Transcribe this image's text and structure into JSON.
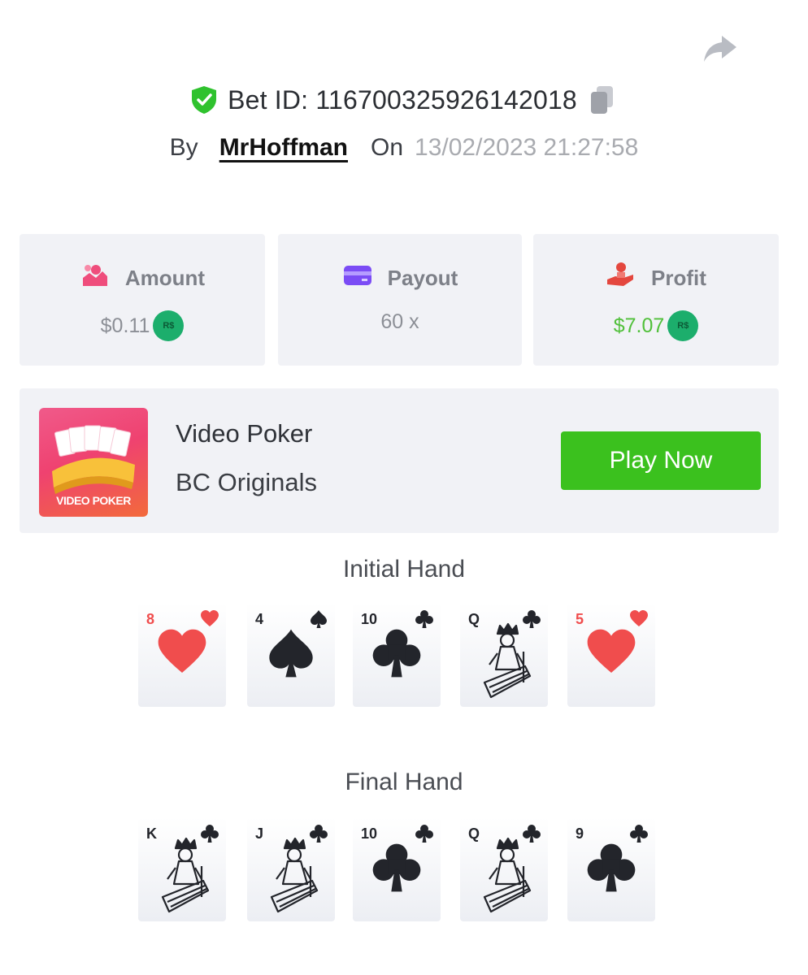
{
  "header": {
    "bet_id_label": "Bet ID: 116700325926142018",
    "by_label": "By",
    "username": "MrHoffman",
    "on_label": "On",
    "datetime": "13/02/2023 21:27:58"
  },
  "stats": {
    "amount": {
      "label": "Amount",
      "value": "$0.11",
      "coin": "R$"
    },
    "payout": {
      "label": "Payout",
      "value": "60 x"
    },
    "profit": {
      "label": "Profit",
      "value": "$7.07",
      "coin": "R$"
    }
  },
  "game": {
    "thumbnail_label": "VIDEO POKER",
    "name": "Video Poker",
    "provider": "BC Originals",
    "play_label": "Play Now"
  },
  "colors": {
    "accent_green": "#3bc11e",
    "profit_green": "#51c03b",
    "card_red": "#f04d4d",
    "card_black": "#23252b",
    "panel_bg": "#f1f2f6"
  },
  "hands": {
    "initial": {
      "title": "Initial Hand",
      "cards": [
        {
          "rank": "8",
          "suit": "hearts"
        },
        {
          "rank": "4",
          "suit": "spades"
        },
        {
          "rank": "10",
          "suit": "clubs"
        },
        {
          "rank": "Q",
          "suit": "clubs"
        },
        {
          "rank": "5",
          "suit": "hearts"
        }
      ]
    },
    "final": {
      "title": "Final Hand",
      "cards": [
        {
          "rank": "K",
          "suit": "clubs"
        },
        {
          "rank": "J",
          "suit": "clubs"
        },
        {
          "rank": "10",
          "suit": "clubs"
        },
        {
          "rank": "Q",
          "suit": "clubs"
        },
        {
          "rank": "9",
          "suit": "clubs"
        }
      ]
    }
  }
}
